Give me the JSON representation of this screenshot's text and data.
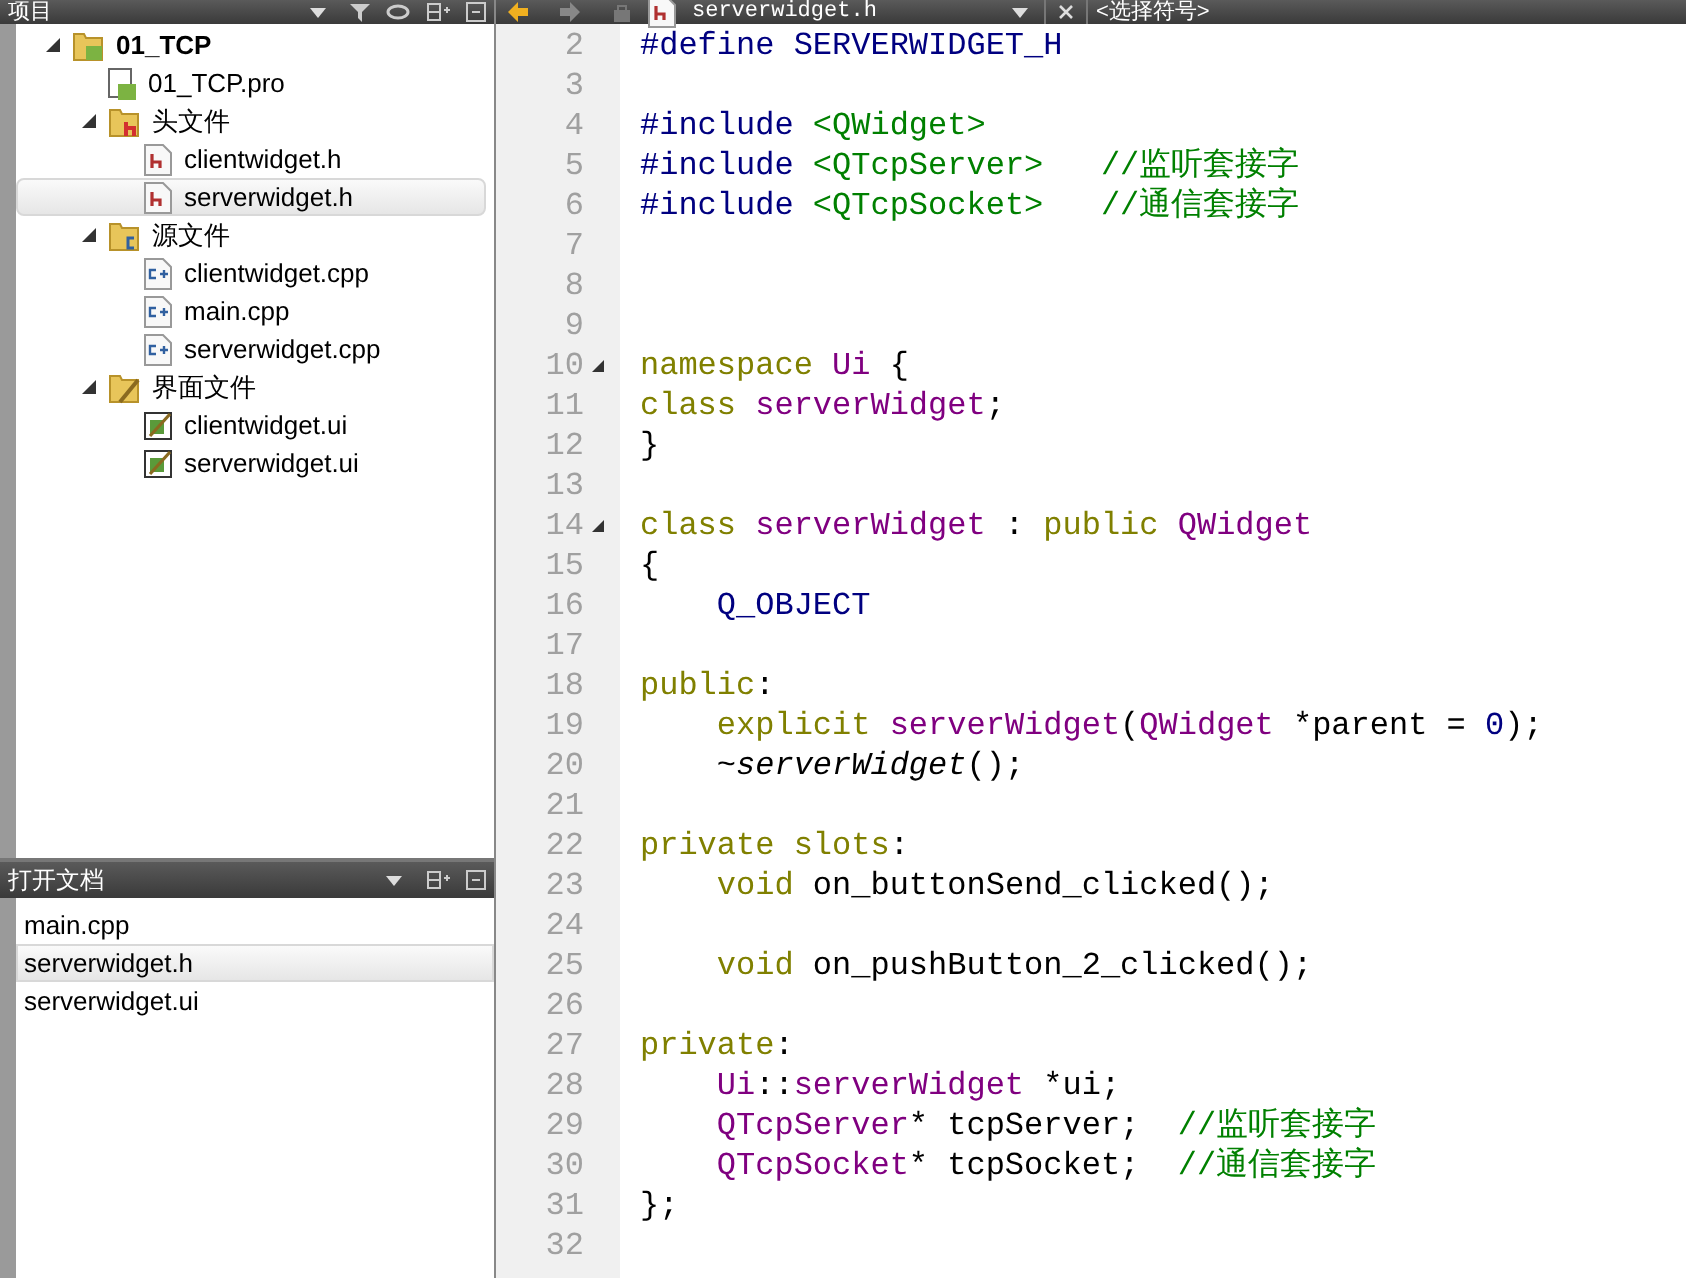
{
  "project_panel": {
    "title": "项目"
  },
  "project_tree": [
    {
      "label": "01_TCP",
      "kind": "project",
      "expanded": true,
      "selected": false,
      "children": [
        {
          "label": "01_TCP.pro",
          "kind": "pro",
          "selected": false
        },
        {
          "label": "头文件",
          "kind": "folder-h",
          "expanded": true,
          "selected": false,
          "children": [
            {
              "label": "clientwidget.h",
              "kind": "h",
              "selected": false
            },
            {
              "label": "serverwidget.h",
              "kind": "h",
              "selected": true
            }
          ]
        },
        {
          "label": "源文件",
          "kind": "folder-cpp",
          "expanded": true,
          "selected": false,
          "children": [
            {
              "label": "clientwidget.cpp",
              "kind": "cpp",
              "selected": false
            },
            {
              "label": "main.cpp",
              "kind": "cpp",
              "selected": false
            },
            {
              "label": "serverwidget.cpp",
              "kind": "cpp",
              "selected": false
            }
          ]
        },
        {
          "label": "界面文件",
          "kind": "folder-ui",
          "expanded": true,
          "selected": false,
          "children": [
            {
              "label": "clientwidget.ui",
              "kind": "ui",
              "selected": false
            },
            {
              "label": "serverwidget.ui",
              "kind": "ui",
              "selected": false
            }
          ]
        }
      ]
    }
  ],
  "open_documents": {
    "title": "打开文档",
    "items": [
      {
        "label": "main.cpp",
        "selected": false
      },
      {
        "label": "serverwidget.h",
        "selected": true
      },
      {
        "label": "serverwidget.ui",
        "selected": false
      }
    ]
  },
  "editor_toolbar": {
    "file_name": "serverwidget.h",
    "symbol_selector": "<选择符号>"
  },
  "code_lines": [
    {
      "number": "2",
      "fold": false,
      "tokens": [
        {
          "text": "#define SERVERWIDGET_H",
          "kind": "preproc"
        }
      ]
    },
    {
      "number": "3",
      "fold": false
    },
    {
      "number": "4",
      "fold": false,
      "tokens": [
        {
          "text": "#include ",
          "kind": "preproc"
        },
        {
          "text": "<QWidget>",
          "kind": "string"
        }
      ]
    },
    {
      "number": "5",
      "fold": false,
      "tokens": [
        {
          "text": "#include ",
          "kind": "preproc"
        },
        {
          "text": "<QTcpServer>   ",
          "kind": "string"
        },
        {
          "text": "//监听套接字",
          "kind": "comment"
        }
      ]
    },
    {
      "number": "6",
      "fold": false,
      "tokens": [
        {
          "text": "#include ",
          "kind": "preproc"
        },
        {
          "text": "<QTcpSocket>   ",
          "kind": "string"
        },
        {
          "text": "//通信套接字",
          "kind": "comment"
        }
      ]
    },
    {
      "number": "7",
      "fold": false
    },
    {
      "number": "8",
      "fold": false
    },
    {
      "number": "9",
      "fold": false
    },
    {
      "number": "10",
      "fold": true,
      "tokens": [
        {
          "text": "namespace ",
          "kind": "keyword"
        },
        {
          "text": "Ui",
          "kind": "type"
        },
        {
          "text": " {",
          "kind": "plain"
        }
      ]
    },
    {
      "number": "11",
      "fold": false,
      "tokens": [
        {
          "text": "class ",
          "kind": "keyword"
        },
        {
          "text": "serverWidget",
          "kind": "type"
        },
        {
          "text": ";",
          "kind": "plain"
        }
      ]
    },
    {
      "number": "12",
      "fold": false,
      "tokens": [
        {
          "text": "}",
          "kind": "plain"
        }
      ]
    },
    {
      "number": "13",
      "fold": false
    },
    {
      "number": "14",
      "fold": true,
      "tokens": [
        {
          "text": "class ",
          "kind": "keyword"
        },
        {
          "text": "serverWidget",
          "kind": "type"
        },
        {
          "text": " : ",
          "kind": "plain"
        },
        {
          "text": "public ",
          "kind": "keyword"
        },
        {
          "text": "QWidget",
          "kind": "type"
        }
      ]
    },
    {
      "number": "15",
      "fold": false,
      "tokens": [
        {
          "text": "{",
          "kind": "plain"
        }
      ]
    },
    {
      "number": "16",
      "fold": false,
      "tokens": [
        {
          "text": "    Q_OBJECT",
          "kind": "preproc"
        }
      ]
    },
    {
      "number": "17",
      "fold": false
    },
    {
      "number": "18",
      "fold": false,
      "tokens": [
        {
          "text": "public",
          "kind": "keyword"
        },
        {
          "text": ":",
          "kind": "plain"
        }
      ]
    },
    {
      "number": "19",
      "fold": false,
      "tokens": [
        {
          "text": "    explicit ",
          "kind": "keyword"
        },
        {
          "text": "serverWidget",
          "kind": "type"
        },
        {
          "text": "(",
          "kind": "plain"
        },
        {
          "text": "QWidget",
          "kind": "type"
        },
        {
          "text": " *parent = ",
          "kind": "plain"
        },
        {
          "text": "0",
          "kind": "number"
        },
        {
          "text": ");",
          "kind": "plain"
        }
      ]
    },
    {
      "number": "20",
      "fold": false,
      "tokens": [
        {
          "text": "    ~",
          "kind": "plain"
        },
        {
          "text": "serverWidget",
          "kind": "italic"
        },
        {
          "text": "();",
          "kind": "plain"
        }
      ]
    },
    {
      "number": "21",
      "fold": false
    },
    {
      "number": "22",
      "fold": false,
      "tokens": [
        {
          "text": "private slots",
          "kind": "keyword"
        },
        {
          "text": ":",
          "kind": "plain"
        }
      ]
    },
    {
      "number": "23",
      "fold": false,
      "tokens": [
        {
          "text": "    void ",
          "kind": "keyword"
        },
        {
          "text": "on_buttonSend_clicked();",
          "kind": "plain"
        }
      ]
    },
    {
      "number": "24",
      "fold": false
    },
    {
      "number": "25",
      "fold": false,
      "tokens": [
        {
          "text": "    void ",
          "kind": "keyword"
        },
        {
          "text": "on_pushButton_2_clicked();",
          "kind": "plain"
        }
      ]
    },
    {
      "number": "26",
      "fold": false
    },
    {
      "number": "27",
      "fold": false,
      "tokens": [
        {
          "text": "private",
          "kind": "keyword"
        },
        {
          "text": ":",
          "kind": "plain"
        }
      ]
    },
    {
      "number": "28",
      "fold": false,
      "tokens": [
        {
          "text": "    Ui",
          "kind": "type"
        },
        {
          "text": "::",
          "kind": "plain"
        },
        {
          "text": "serverWidget",
          "kind": "type"
        },
        {
          "text": " *ui;",
          "kind": "plain"
        }
      ]
    },
    {
      "number": "29",
      "fold": false,
      "tokens": [
        {
          "text": "    QTcpServer",
          "kind": "type"
        },
        {
          "text": "* tcpServer;  ",
          "kind": "plain"
        },
        {
          "text": "//监听套接字",
          "kind": "comment"
        }
      ]
    },
    {
      "number": "30",
      "fold": false,
      "tokens": [
        {
          "text": "    QTcpSocket",
          "kind": "type"
        },
        {
          "text": "* tcpSocket;  ",
          "kind": "plain"
        },
        {
          "text": "//通信套接字",
          "kind": "comment"
        }
      ]
    },
    {
      "number": "31",
      "fold": false,
      "tokens": [
        {
          "text": "};",
          "kind": "plain"
        }
      ]
    },
    {
      "number": "32",
      "fold": false
    }
  ]
}
